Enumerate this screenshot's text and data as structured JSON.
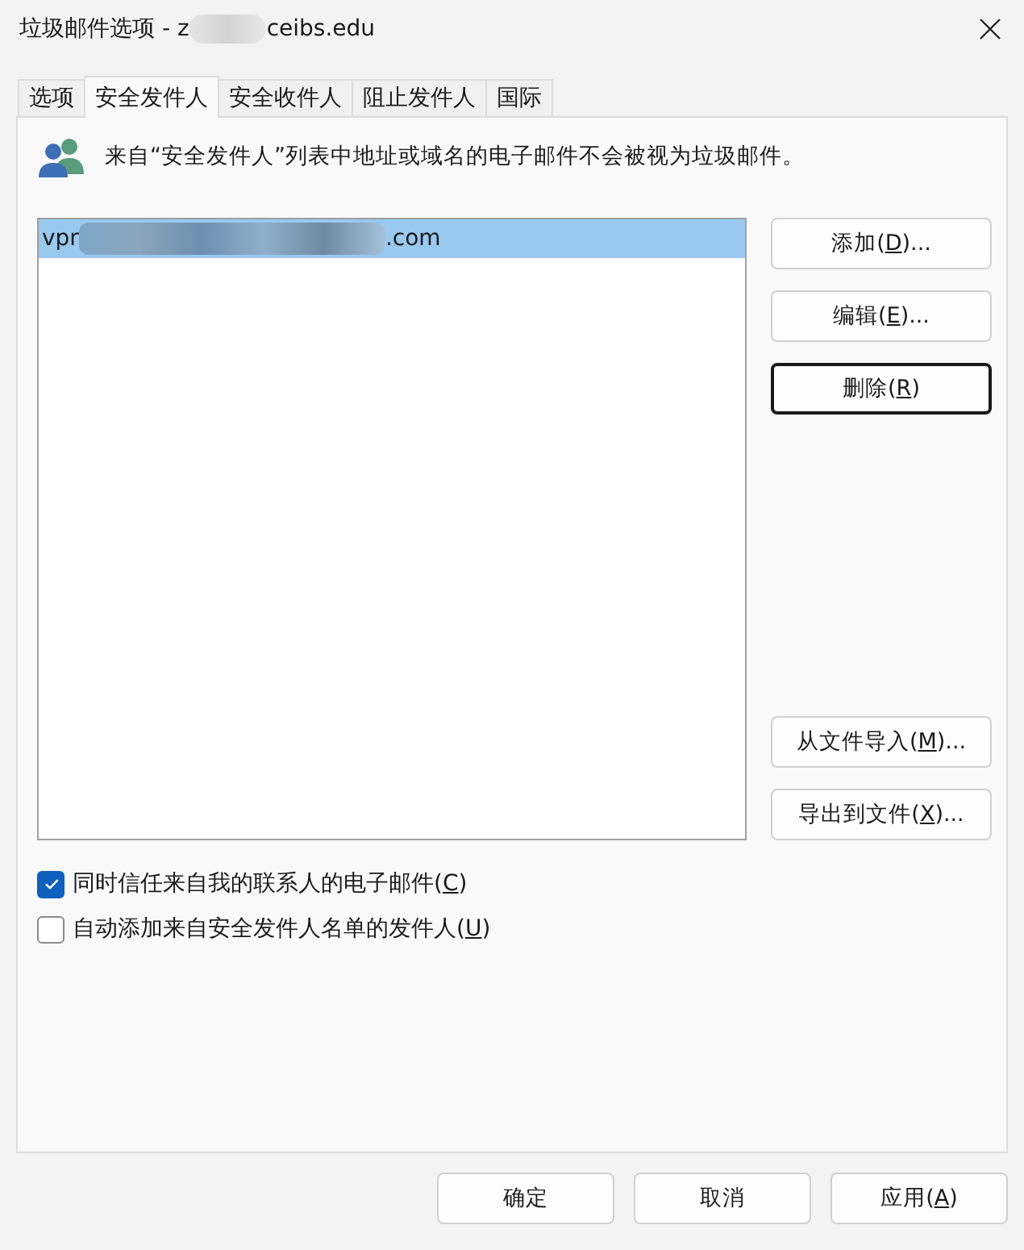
{
  "window": {
    "title": {
      "before": "垃圾邮件选项 - z",
      "after": "ceibs.edu",
      "redacted": true
    }
  },
  "tabs": [
    {
      "label": "选项",
      "selected": false
    },
    {
      "label": "安全发件人",
      "selected": true
    },
    {
      "label": "安全收件人",
      "selected": false
    },
    {
      "label": "阻止发件人",
      "selected": false
    },
    {
      "label": "国际",
      "selected": false
    }
  ],
  "info_text": "来自“安全发件人”列表中地址或域名的电子邮件不会被视为垃圾邮件。",
  "list": {
    "items": [
      {
        "before": "vpr",
        "after": ".com",
        "redacted": true,
        "selected": true
      }
    ]
  },
  "side_buttons_top": [
    {
      "before": "添加(",
      "key": "D",
      "after": ")...",
      "focused": false
    },
    {
      "before": "编辑(",
      "key": "E",
      "after": ")...",
      "focused": false
    },
    {
      "before": "删除(",
      "key": "R",
      "after": ")",
      "focused": true
    }
  ],
  "side_buttons_bottom": [
    {
      "before": "从文件导入(",
      "key": "M",
      "after": ")...",
      "focused": false
    },
    {
      "before": "导出到文件(",
      "key": "X",
      "after": ")...",
      "focused": false
    }
  ],
  "checkboxes": [
    {
      "before": "同时信任来自我的联系人的电子邮件(",
      "key": "C",
      "after": ")",
      "checked": true
    },
    {
      "before": "自动添加来自安全发件人名单的发件人(",
      "key": "U",
      "after": ")",
      "checked": false
    }
  ],
  "footer_buttons": [
    {
      "before": "确定"
    },
    {
      "before": "取消"
    },
    {
      "before": "应用(",
      "key": "A",
      "after": ")"
    }
  ]
}
